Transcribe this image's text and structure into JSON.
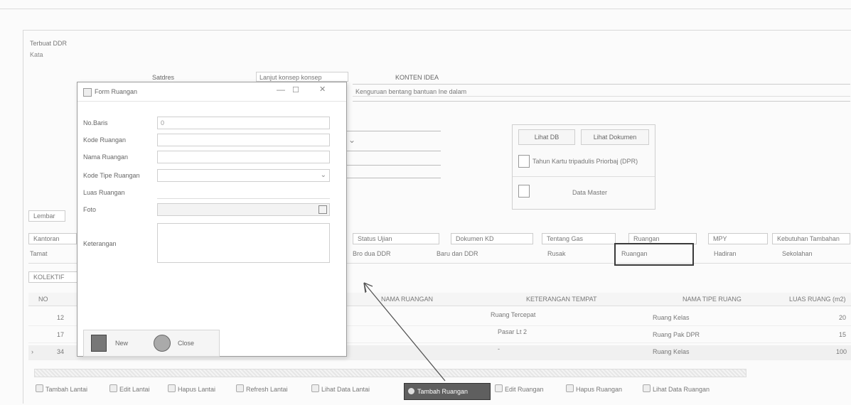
{
  "window": {
    "title": "Terbuat DDR",
    "subtitle": "Kata"
  },
  "header": {
    "field1_label": "Satdres",
    "field1_value": "Lanjut konsep konsep",
    "field2_label": "KONTEN IDEA",
    "field2_value": "Kenguruan bentang bantuan Ine dalam"
  },
  "right_panel": {
    "tab_a": "Lihat DB",
    "tab_b": "Lihat Dokumen",
    "item1": "Tahun Kartu tripadulis Priorbaj (DPR)",
    "item2": "Data Master"
  },
  "left_tag": "Lembar",
  "tabs": [
    "Kantoran",
    "Status Ujian",
    "Dokumen KD",
    "Tentang Gas",
    "Ruangan",
    "MPY",
    "Kebutuhan Tambahan"
  ],
  "row_values": {
    "r0": "Tamat",
    "r1": "Bro dua DDR",
    "r2": "Baru dan DDR",
    "r3": "Rusak",
    "r4": "Ruangan",
    "r5": "Hadiran",
    "r6": "Sekolahan"
  },
  "subtab": "KOLEKTIF",
  "grid": {
    "headers": [
      "NO",
      "NAMA RUANGAN",
      "KETERANGAN TEMPAT",
      "NAMA TIPE RUANG",
      "LUAS RUANG (m2)"
    ],
    "rows": [
      {
        "no": "12",
        "keterangan": "Ruang Tercepat",
        "tipe": "Ruang Kelas",
        "luas": "20"
      },
      {
        "no": "17",
        "keterangan": "Pasar Lt 2",
        "tipe": "Ruang Pak DPR",
        "luas": "15"
      },
      {
        "no": "34",
        "keterangan": "-",
        "tipe": "Ruang Kelas",
        "luas": "100"
      }
    ]
  },
  "status_bar": [
    "Tambah Lantai",
    "Edit Lantai",
    "Hapus Lantai",
    "Refresh Lantai",
    "Lihat Data Lantai",
    "Tambah Ruangan",
    "Edit Ruangan",
    "Hapus Ruangan",
    "Lihat Data Ruangan"
  ],
  "dialog": {
    "title": "Form Ruangan",
    "labels": [
      "No.Baris",
      "Kode Ruangan",
      "Nama Ruangan",
      "Kode Tipe Ruangan",
      "Luas Ruangan",
      "Foto",
      "Keterangan"
    ],
    "no_baris_value": "0",
    "btn_new": "New",
    "btn_close": "Close"
  },
  "colors": {
    "highlight_button": "#5f5f5f",
    "arrow": "#555555"
  }
}
